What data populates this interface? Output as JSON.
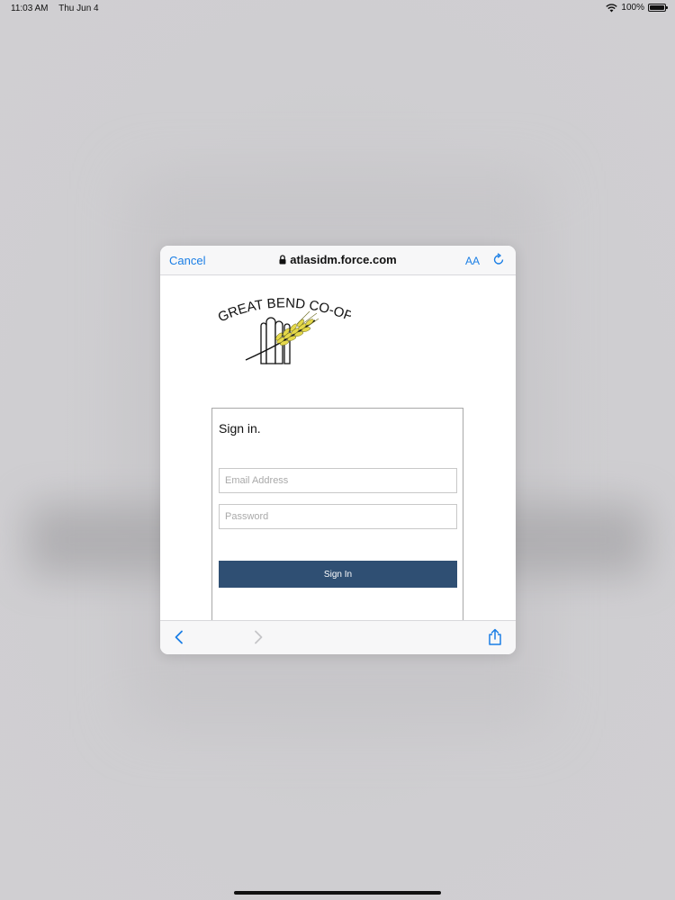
{
  "status_bar": {
    "time": "11:03 AM",
    "date": "Thu Jun 4",
    "battery_label": "100%",
    "battery_level": 1.0,
    "icons": [
      "wifi-icon",
      "battery-icon"
    ]
  },
  "browser": {
    "cancel_label": "Cancel",
    "url": "atlasidm.force.com",
    "text_size_label": "AA",
    "icons": [
      "lock-icon",
      "reload-icon",
      "back-icon",
      "forward-icon",
      "share-icon"
    ]
  },
  "logo": {
    "text": "GREAT BEND CO-OP"
  },
  "signin": {
    "title": "Sign in.",
    "email_placeholder": "Email Address",
    "password_placeholder": "Password",
    "button_label": "Sign In"
  },
  "colors": {
    "accent": "#1a7ee5",
    "button": "#2f4f73",
    "background": "#cbcacd"
  }
}
